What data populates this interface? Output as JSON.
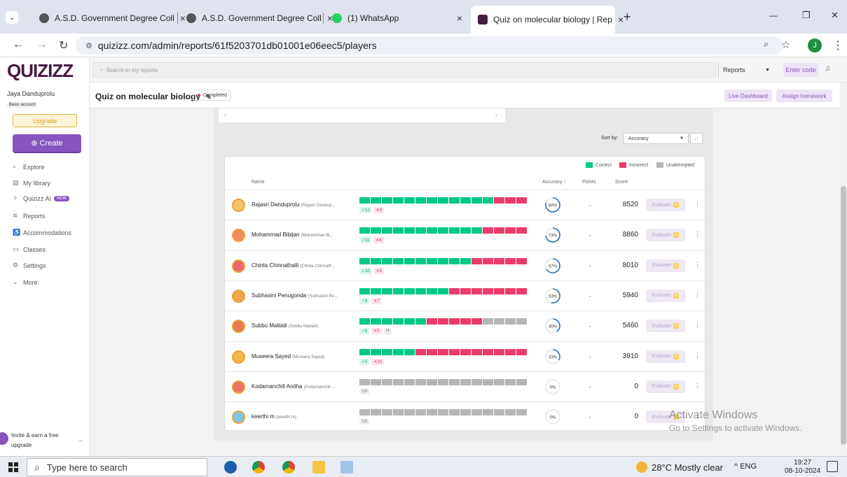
{
  "browser": {
    "tabs": [
      {
        "title": "A.S.D. Government Degree Coll",
        "close": "×"
      },
      {
        "title": "A.S.D. Government Degree Coll",
        "close": "×"
      },
      {
        "title": "(1) WhatsApp",
        "close": "×"
      },
      {
        "title": "Quiz on molecular biology | Rep",
        "close": "×"
      }
    ],
    "new_tab": "+",
    "url": "quizizz.com/admin/reports/61f5203701db01001e06eec5/players",
    "profile_initial": "J",
    "window_controls": {
      "minimize": "—",
      "restore": "❐",
      "close": "✕"
    }
  },
  "sidebar": {
    "logo": "QUIZIZZ",
    "user_name": "Jaya Danduprolu",
    "account_type": "Basic account",
    "upgrade_label": "Upgrade",
    "create_label": "⊕ Create",
    "nav": [
      {
        "label": "Explore",
        "icon": "explore-icon",
        "glyph": "⌕"
      },
      {
        "label": "My library",
        "icon": "library-icon",
        "glyph": "▤"
      },
      {
        "label": "Quizizz AI",
        "icon": "ai-icon",
        "glyph": "✧",
        "badge": "NEW"
      },
      {
        "label": "Reports",
        "icon": "reports-icon",
        "glyph": "≋"
      },
      {
        "label": "Accommodations",
        "icon": "accommodations-icon",
        "glyph": "♿"
      },
      {
        "label": "Classes",
        "icon": "classes-icon",
        "glyph": "▭"
      },
      {
        "label": "Settings",
        "icon": "settings-icon",
        "glyph": "⚙"
      },
      {
        "label": "More",
        "icon": "chevron-down-icon",
        "glyph": "⌄"
      }
    ],
    "invite_line1": "Invite & earn a free",
    "invite_line2": "upgrade"
  },
  "topnav": {
    "search_placeholder": "Search in my reports",
    "reports_label": "Reports",
    "enter_code_label": "Enter code"
  },
  "header": {
    "quiz_title": "Quiz on molecular biology",
    "status": "Completed",
    "live_dashboard": "Live Dashboard",
    "assign_homework": "Assign homework"
  },
  "controls": {
    "sort_label": "Sort by:",
    "sort_value": "Accuracy"
  },
  "legend": {
    "correct": "Correct",
    "incorrect": "Incorrect",
    "unattempted": "Unattempted"
  },
  "colors": {
    "correct": "#00c985",
    "incorrect": "#ec3b6a",
    "unattempted": "#b5b5b5",
    "accuracy_ring": "#2d70ae",
    "brand": "#8854c0"
  },
  "columns": {
    "name": "Name",
    "accuracy": "Accuracy ↑",
    "points": "Points",
    "score": "Score"
  },
  "evaluate_label": "Evaluate",
  "players": [
    {
      "name": "Rajasri Danduprolu",
      "alias": "(Rajasri Dandup...",
      "correct": 12,
      "incorrect": 3,
      "unattempted": 0,
      "accuracy": 80,
      "accuracy_label": "80%",
      "points": "-",
      "score": "8520",
      "counts": [
        "✓12",
        "✕3"
      ],
      "answers": [
        "c",
        "c",
        "c",
        "c",
        "c",
        "c",
        "c",
        "c",
        "c",
        "c",
        "c",
        "c",
        "i",
        "i",
        "i"
      ]
    },
    {
      "name": "Mohammad Bibijan",
      "alias": "(Mohammad Bi...",
      "correct": 11,
      "incorrect": 4,
      "unattempted": 0,
      "accuracy": 73,
      "accuracy_label": "73%",
      "points": "-",
      "score": "8860",
      "counts": [
        "✓11",
        "✕4"
      ],
      "answers": [
        "c",
        "c",
        "c",
        "c",
        "c",
        "c",
        "c",
        "c",
        "c",
        "c",
        "c",
        "i",
        "i",
        "i",
        "i"
      ]
    },
    {
      "name": "Chinta Chinnathalli",
      "alias": "(Chinta Chinnath...",
      "correct": 10,
      "incorrect": 5,
      "unattempted": 0,
      "accuracy": 67,
      "accuracy_label": "67%",
      "points": "-",
      "score": "8010",
      "counts": [
        "✓10",
        "✕5"
      ],
      "answers": [
        "c",
        "c",
        "c",
        "c",
        "c",
        "c",
        "c",
        "c",
        "c",
        "c",
        "i",
        "i",
        "i",
        "i",
        "i"
      ]
    },
    {
      "name": "Subhasini Penugonda",
      "alias": "(Subhasini Pe...",
      "correct": 8,
      "incorrect": 7,
      "unattempted": 0,
      "accuracy": 53,
      "accuracy_label": "53%",
      "points": "-",
      "score": "5940",
      "counts": [
        "✓8",
        "✕7"
      ],
      "answers": [
        "c",
        "c",
        "c",
        "c",
        "c",
        "c",
        "c",
        "c",
        "i",
        "i",
        "i",
        "i",
        "i",
        "i",
        "i"
      ]
    },
    {
      "name": "Subbu Malladi",
      "alias": "(Subbu Malladi)",
      "correct": 6,
      "incorrect": 5,
      "unattempted": 4,
      "accuracy": 40,
      "accuracy_label": "40%",
      "points": "-",
      "score": "5460",
      "counts": [
        "✓6",
        "✕5",
        "!4"
      ],
      "answers": [
        "c",
        "c",
        "c",
        "c",
        "c",
        "c",
        "i",
        "i",
        "i",
        "i",
        "i",
        "u",
        "u",
        "u",
        "u"
      ]
    },
    {
      "name": "Museera Sayed",
      "alias": "(Museera Sayed)",
      "correct": 5,
      "incorrect": 10,
      "unattempted": 0,
      "accuracy": 33,
      "accuracy_label": "33%",
      "points": "-",
      "score": "3910",
      "counts": [
        "✓5",
        "✕10"
      ],
      "answers": [
        "c",
        "c",
        "c",
        "c",
        "c",
        "i",
        "i",
        "i",
        "i",
        "i",
        "i",
        "i",
        "i",
        "i",
        "i"
      ]
    },
    {
      "name": "Kodamanchili Anitha",
      "alias": "(Kodamanchili ...",
      "correct": 0,
      "incorrect": 0,
      "unattempted": 15,
      "accuracy": 0,
      "accuracy_label": "0%",
      "points": "-",
      "score": "0",
      "counts": [
        "!15"
      ],
      "answers": [
        "u",
        "u",
        "u",
        "u",
        "u",
        "u",
        "u",
        "u",
        "u",
        "u",
        "u",
        "u",
        "u",
        "u",
        "u"
      ]
    },
    {
      "name": "keerthi m",
      "alias": "(keerthi m)",
      "correct": 0,
      "incorrect": 0,
      "unattempted": 15,
      "accuracy": 0,
      "accuracy_label": "0%",
      "points": "-",
      "score": "0",
      "counts": [
        "!15"
      ],
      "answers": [
        "u",
        "u",
        "u",
        "u",
        "u",
        "u",
        "u",
        "u",
        "u",
        "u",
        "u",
        "u",
        "u",
        "u",
        "u"
      ]
    }
  ],
  "watermark": {
    "line1": "Activate Windows",
    "line2": "Go to Settings to activate Windows."
  },
  "taskbar": {
    "search_placeholder": "Type here to search",
    "weather": "28°C  Mostly clear",
    "tray": "^  ENG",
    "time": "19:27",
    "date": "08-10-2024"
  }
}
